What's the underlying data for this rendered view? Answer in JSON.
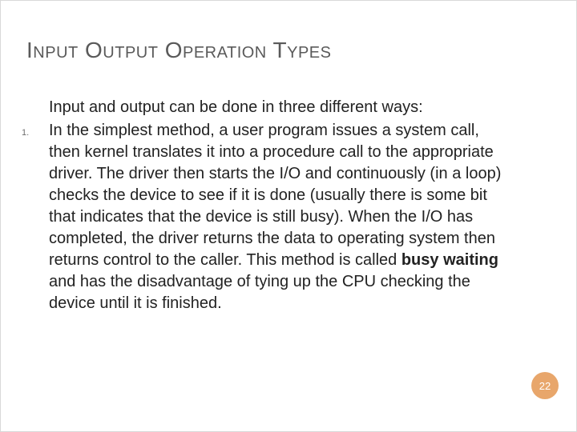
{
  "title": "Input Output Operation Types",
  "intro": "Input and output can be done in three different ways:",
  "list_number": "1.",
  "item_pre": "In the simplest method, a user program issues a system call, then kernel translates it into a procedure call to the appropriate driver. The driver then starts the I/O and continuously (in a loop) checks the device to see if it is done (usually there is some bit that indicates that the device is still busy). When the I/O has completed, the driver returns the data to operating system then returns control to the caller. This method is called ",
  "item_bold": "busy waiting",
  "item_post": " and has the disadvantage of tying up the CPU checking the device until it is finished.",
  "page_number": "22"
}
